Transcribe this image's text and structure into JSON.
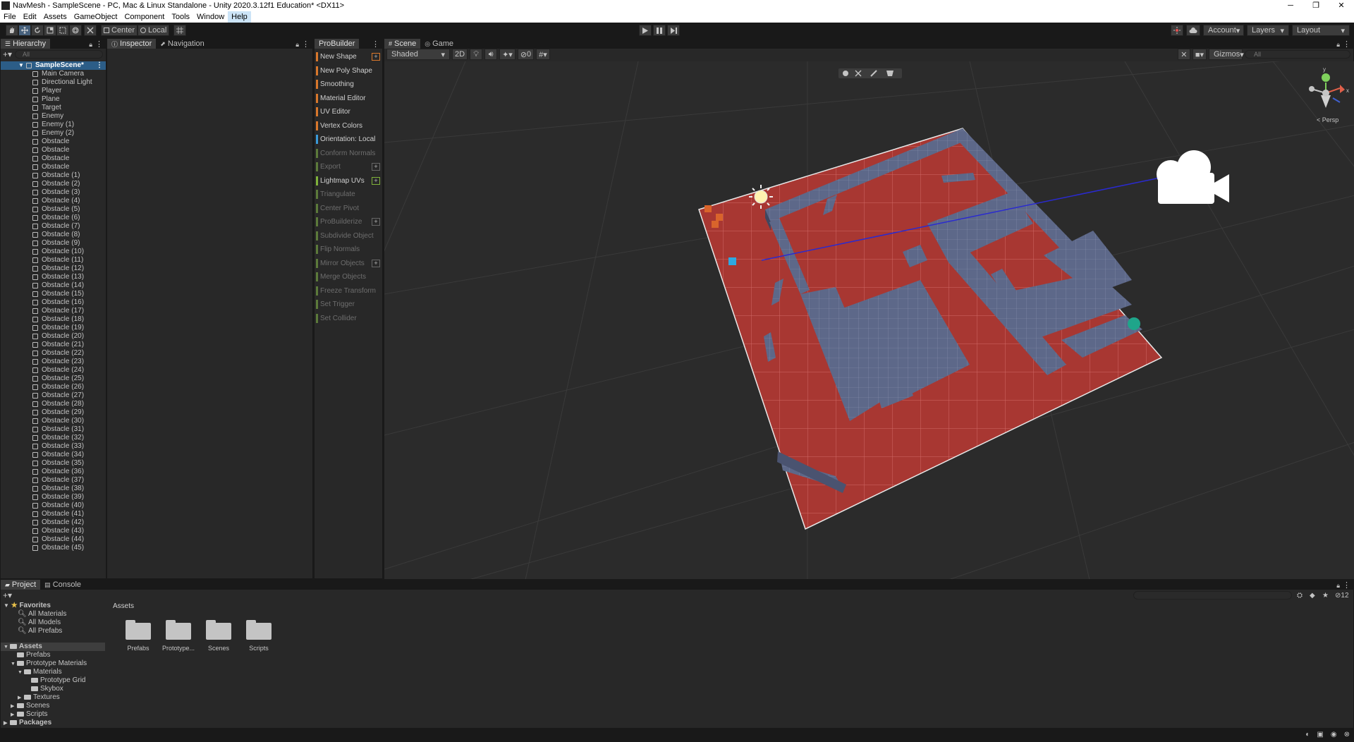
{
  "window": {
    "title": "NavMesh - SampleScene - PC, Mac & Linux Standalone - Unity 2020.3.12f1 Education* <DX11>",
    "controls": [
      "─",
      "❐",
      "✕"
    ]
  },
  "menu": [
    "File",
    "Edit",
    "Assets",
    "GameObject",
    "Component",
    "Tools",
    "Window",
    "Help"
  ],
  "toolbar": {
    "pivot": "Center",
    "space": "Local",
    "account": "Account",
    "layers": "Layers",
    "layout": "Layout"
  },
  "hierarchy": {
    "tab": "Hierarchy",
    "search_placeholder": "All",
    "scene": "SampleScene*",
    "items": [
      "Main Camera",
      "Directional Light",
      "Player",
      "Plane",
      "Target",
      "Enemy",
      "Enemy (1)",
      "Enemy (2)",
      "Obstacle",
      "Obstacle",
      "Obstacle",
      "Obstacle",
      "Obstacle (1)",
      "Obstacle (2)",
      "Obstacle (3)",
      "Obstacle (4)",
      "Obstacle (5)",
      "Obstacle (6)",
      "Obstacle (7)",
      "Obstacle (8)",
      "Obstacle (9)",
      "Obstacle (10)",
      "Obstacle (11)",
      "Obstacle (12)",
      "Obstacle (13)",
      "Obstacle (14)",
      "Obstacle (15)",
      "Obstacle (16)",
      "Obstacle (17)",
      "Obstacle (18)",
      "Obstacle (19)",
      "Obstacle (20)",
      "Obstacle (21)",
      "Obstacle (22)",
      "Obstacle (23)",
      "Obstacle (24)",
      "Obstacle (25)",
      "Obstacle (26)",
      "Obstacle (27)",
      "Obstacle (28)",
      "Obstacle (29)",
      "Obstacle (30)",
      "Obstacle (31)",
      "Obstacle (32)",
      "Obstacle (33)",
      "Obstacle (34)",
      "Obstacle (35)",
      "Obstacle (36)",
      "Obstacle (37)",
      "Obstacle (38)",
      "Obstacle (39)",
      "Obstacle (40)",
      "Obstacle (41)",
      "Obstacle (42)",
      "Obstacle (43)",
      "Obstacle (44)",
      "Obstacle (45)"
    ]
  },
  "inspector": {
    "tabs": [
      "Inspector",
      "Navigation"
    ]
  },
  "probuilder": {
    "tab": "ProBuilder",
    "items": [
      {
        "label": "New Shape",
        "color": "#d9772b",
        "enabled": true,
        "plus": true
      },
      {
        "label": "New Poly Shape",
        "color": "#d9772b",
        "enabled": true,
        "plus": false
      },
      {
        "label": "Smoothing",
        "color": "#d9772b",
        "enabled": true,
        "plus": false
      },
      {
        "label": "Material Editor",
        "color": "#d9772b",
        "enabled": true,
        "plus": false
      },
      {
        "label": "UV Editor",
        "color": "#d9772b",
        "enabled": true,
        "plus": false
      },
      {
        "label": "Vertex Colors",
        "color": "#d9772b",
        "enabled": true,
        "plus": false
      },
      {
        "label": "Orientation: Local",
        "color": "#3a9ad9",
        "enabled": true,
        "plus": false
      },
      {
        "label": "Conform Normals",
        "color": "#5c7a3a",
        "enabled": false,
        "plus": false
      },
      {
        "label": "Export",
        "color": "#5c7a3a",
        "enabled": false,
        "plus": true
      },
      {
        "label": "Lightmap UVs",
        "color": "#7fb23a",
        "enabled": true,
        "plus": true
      },
      {
        "label": "Triangulate",
        "color": "#5c7a3a",
        "enabled": false,
        "plus": false
      },
      {
        "label": "Center Pivot",
        "color": "#5c7a3a",
        "enabled": false,
        "plus": false
      },
      {
        "label": "ProBuilderize",
        "color": "#5c7a3a",
        "enabled": false,
        "plus": true
      },
      {
        "label": "Subdivide Object",
        "color": "#5c7a3a",
        "enabled": false,
        "plus": false
      },
      {
        "label": "Flip Normals",
        "color": "#5c7a3a",
        "enabled": false,
        "plus": false
      },
      {
        "label": "Mirror Objects",
        "color": "#5c7a3a",
        "enabled": false,
        "plus": true
      },
      {
        "label": "Merge Objects",
        "color": "#5c7a3a",
        "enabled": false,
        "plus": false
      },
      {
        "label": "Freeze Transform",
        "color": "#5c7a3a",
        "enabled": false,
        "plus": false
      },
      {
        "label": "Set Trigger",
        "color": "#5c7a3a",
        "enabled": false,
        "plus": false
      },
      {
        "label": "Set Collider",
        "color": "#5c7a3a",
        "enabled": false,
        "plus": false
      }
    ]
  },
  "scene": {
    "tabs": [
      "Scene",
      "Game"
    ],
    "shading": "Shaded",
    "mode_2d": "2D",
    "hidden_count": "0",
    "gizmos": "Gizmos",
    "search_placeholder": "All",
    "projection": "< Persp",
    "axis_labels": {
      "y": "y",
      "x": "x"
    }
  },
  "project": {
    "tabs": [
      "Project",
      "Console"
    ],
    "favorites": {
      "label": "Favorites",
      "items": [
        "All Materials",
        "All Models",
        "All Prefabs"
      ]
    },
    "tree": [
      {
        "label": "Assets",
        "depth": 0,
        "selected": true,
        "bold": true
      },
      {
        "label": "Prefabs",
        "depth": 1
      },
      {
        "label": "Prototype Materials",
        "depth": 1
      },
      {
        "label": "Materials",
        "depth": 2
      },
      {
        "label": "Prototype Grid",
        "depth": 3
      },
      {
        "label": "Skybox",
        "depth": 3
      },
      {
        "label": "Textures",
        "depth": 2
      },
      {
        "label": "Scenes",
        "depth": 1
      },
      {
        "label": "Scripts",
        "depth": 1
      },
      {
        "label": "Packages",
        "depth": 0,
        "bold": true
      }
    ],
    "breadcrumb": "Assets",
    "folders": [
      "Prefabs",
      "Prototype...",
      "Scenes",
      "Scripts"
    ],
    "badge": "12"
  }
}
